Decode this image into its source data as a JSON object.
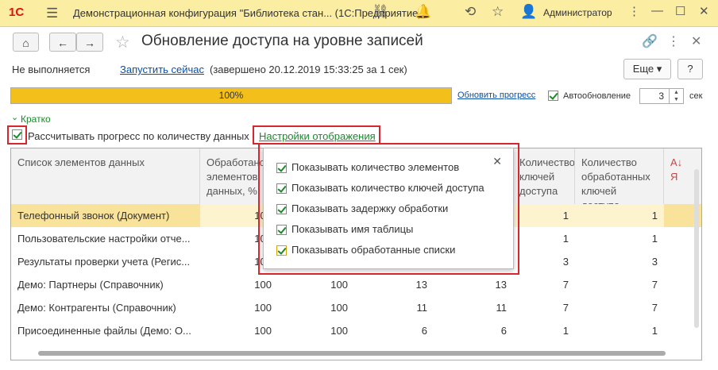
{
  "titlebar": {
    "logo": "1С",
    "title": "Демонстрационная конфигурация \"Библиотека стан...   (1С:Предприятие)",
    "user": "Администратор"
  },
  "toolbar": {
    "home": "⌂",
    "back": "←",
    "forward": "→"
  },
  "page_title": "Обновление доступа на уровне записей",
  "status": {
    "state": "Не выполняется",
    "run_link": "Запустить сейчас",
    "finished": "(завершено 20.12.2019 15:33:25 за 1 сек)",
    "more_label": "Еще",
    "help_label": "?"
  },
  "progress": {
    "value": 100,
    "label": "100%",
    "update_link": "Обновить прогресс",
    "auto_label": "Автообновление",
    "interval": "3",
    "unit": "сек"
  },
  "briefly_label": "Кратко",
  "calc_label": "Рассчитывать прогресс по количеству данных",
  "settings_link": "Настройки отображения",
  "grid": {
    "headers": [
      "Список элементов данных",
      "Обработано элементов данных, %",
      "",
      "",
      "",
      "Количество ключей доступа",
      "Количество обработанных ключей доступа"
    ],
    "rows": [
      [
        "Телефонный звонок (Документ)",
        "100",
        "",
        "",
        "",
        "1",
        "1"
      ],
      [
        "Пользовательские настройки отче...",
        "100",
        "",
        "",
        "",
        "1",
        "1"
      ],
      [
        "Результаты проверки учета (Регис...",
        "100",
        "",
        "",
        "",
        "3",
        "3"
      ],
      [
        "Демо: Партнеры (Справочник)",
        "100",
        "100",
        "13",
        "13",
        "7",
        "7"
      ],
      [
        "Демо: Контрагенты (Справочник)",
        "100",
        "100",
        "11",
        "11",
        "7",
        "7"
      ],
      [
        "Присоединенные файлы (Демо: О...",
        "100",
        "100",
        "6",
        "6",
        "1",
        "1"
      ]
    ]
  },
  "popup": {
    "items": [
      "Показывать количество элементов",
      "Показывать количество ключей доступа",
      "Показывать задержку обработки",
      "Показывать имя таблицы",
      "Показывать обработанные списки"
    ]
  }
}
